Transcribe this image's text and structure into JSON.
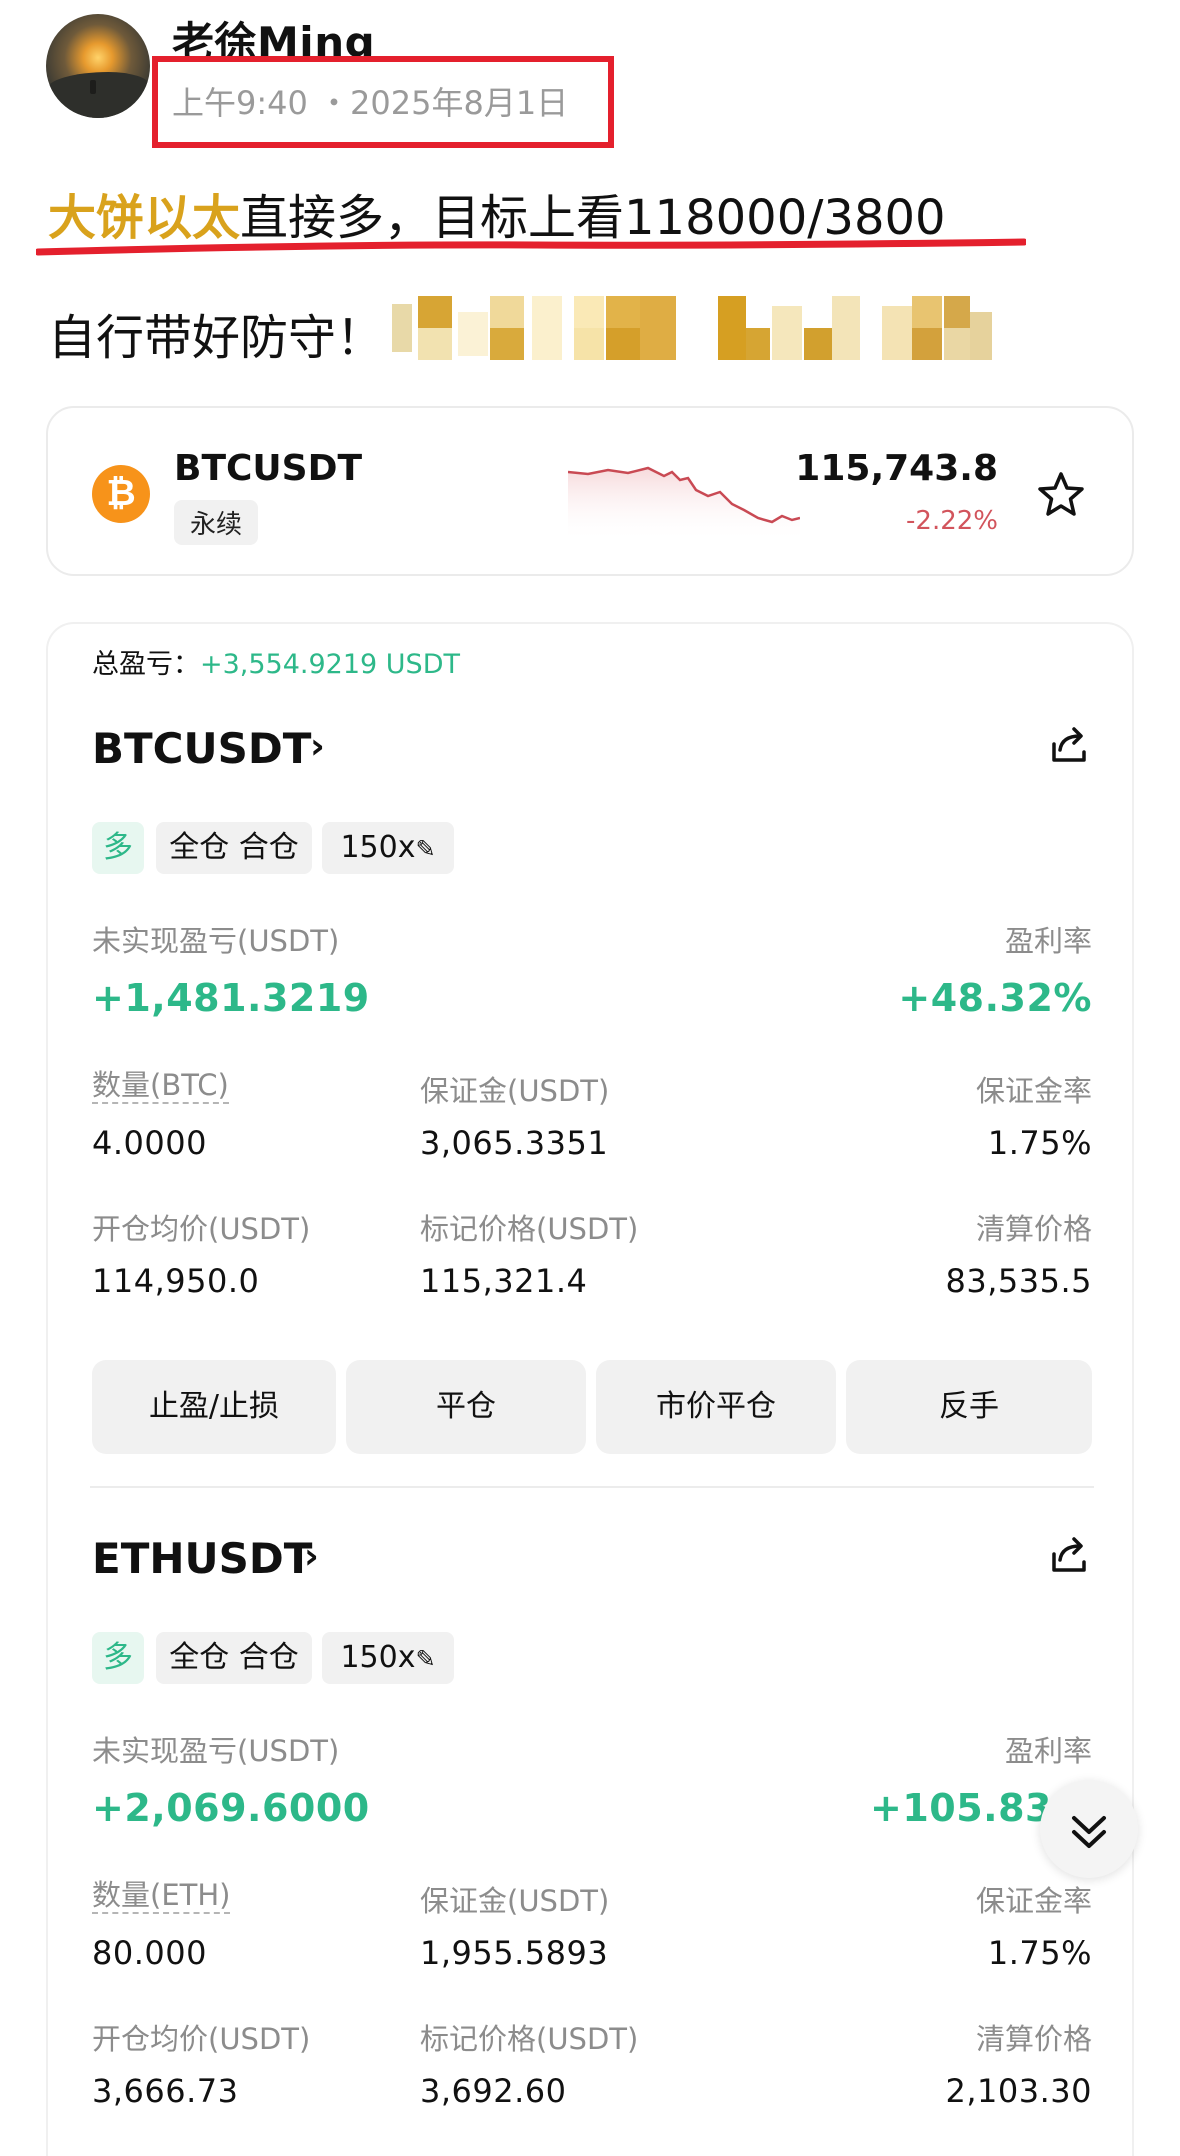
{
  "post": {
    "username": "老徐Ming",
    "time": "上午9:40 ・2025年8月1日",
    "line1_highlight": "大饼以太",
    "line1_rest": "直接多，目标上看118000/3800",
    "line2": "自行带好防守！",
    "highlight_color": "#d9a21c",
    "annotation_color": "#e4202d"
  },
  "ticker": {
    "icon": "bitcoin-icon",
    "symbol": "BTCUSDT",
    "type": "永续",
    "price": "115,743.8",
    "change": "-2.22%",
    "change_color": "#d2545c"
  },
  "positions_summary": {
    "total_label": "总盈亏：",
    "total_value": "+3,554.9219 USDT"
  },
  "positions": [
    {
      "symbol": "BTCUSDT",
      "side": "多",
      "margin_mode": "全仓 合仓",
      "leverage": "150x",
      "unrealized_label": "未实现盈亏(USDT)",
      "unrealized_value": "+1,481.3219",
      "roi_label": "盈利率",
      "roi_value": "+48.32%",
      "qty_label": "数量(BTC)",
      "qty_value": "4.0000",
      "margin_label": "保证金(USDT)",
      "margin_value": "3,065.3351",
      "margin_ratio_label": "保证金率",
      "margin_ratio_value": "1.75%",
      "entry_label": "开仓均价(USDT)",
      "entry_value": "114,950.0",
      "mark_label": "标记价格(USDT)",
      "mark_value": "115,321.4",
      "liq_label": "清算价格",
      "liq_value": "83,535.5",
      "buttons": [
        "止盈/止损",
        "平仓",
        "市价平仓",
        "反手"
      ]
    },
    {
      "symbol": "ETHUSDT",
      "side": "多",
      "margin_mode": "全仓 合仓",
      "leverage": "150x",
      "unrealized_label": "未实现盈亏(USDT)",
      "unrealized_value": "+2,069.6000",
      "roi_label": "盈利率",
      "roi_value": "+105.83",
      "qty_label": "数量(ETH)",
      "qty_value": "80.000",
      "margin_label": "保证金(USDT)",
      "margin_value": "1,955.5893",
      "margin_ratio_label": "保证金率",
      "margin_ratio_value": "1.75%",
      "entry_label": "开仓均价(USDT)",
      "entry_value": "3,666.73",
      "mark_label": "标记价格(USDT)",
      "mark_value": "3,692.60",
      "liq_label": "清算价格",
      "liq_value": "2,103.30"
    }
  ],
  "colors": {
    "profit_green": "#2db889",
    "loss_red": "#d2545c"
  }
}
